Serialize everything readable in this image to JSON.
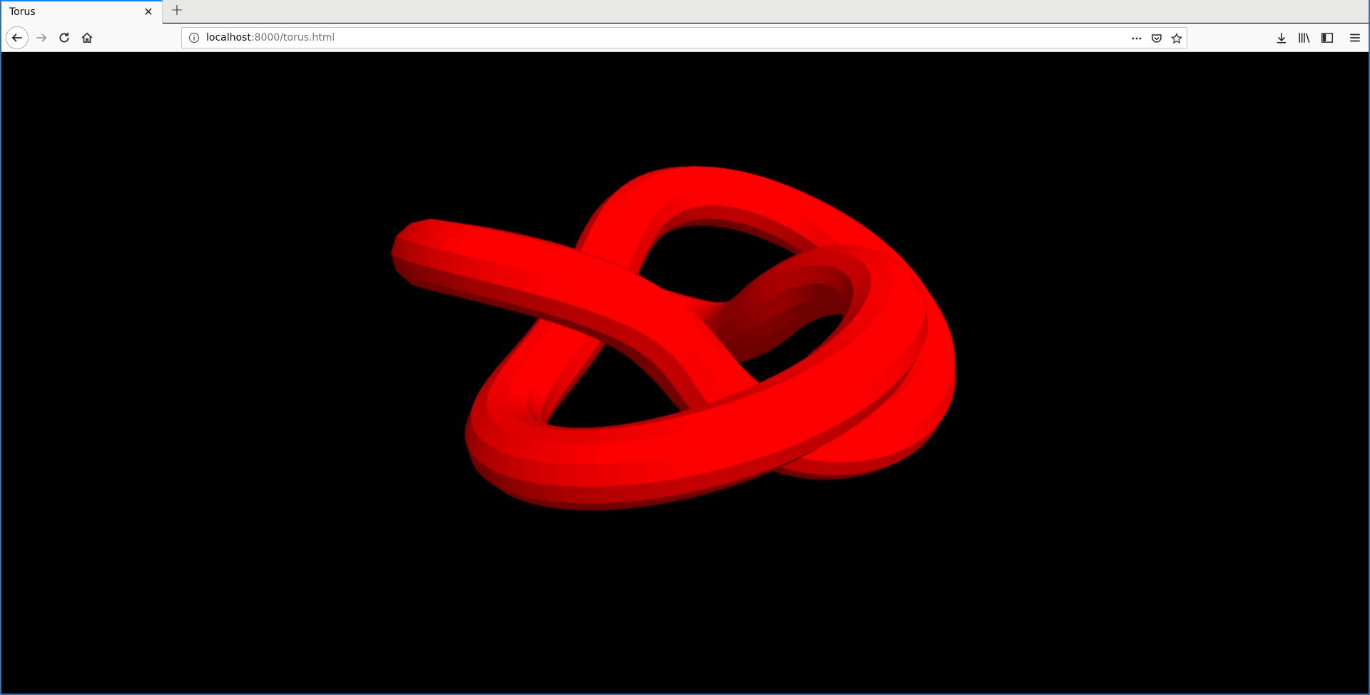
{
  "browser": {
    "tab": {
      "title": "Torus"
    },
    "url": {
      "host": "localhost",
      "rest": ":8000/torus.html"
    }
  },
  "scene": {
    "background": "#000000",
    "object": "torus-knot",
    "color": "#ff0000"
  },
  "icons": [
    "back-arrow-icon",
    "forward-arrow-icon",
    "reload-icon",
    "home-icon",
    "info-icon",
    "more-icon",
    "pocket-icon",
    "bookmark-star-icon",
    "downloads-icon",
    "library-icon",
    "sidebar-icon",
    "menu-icon",
    "close-icon",
    "plus-icon"
  ]
}
